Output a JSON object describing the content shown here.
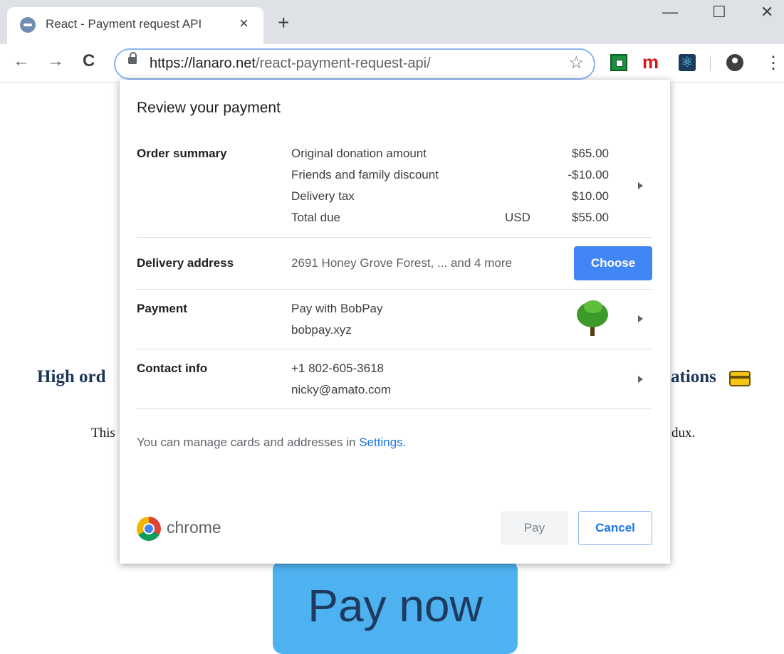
{
  "browser": {
    "tab_title": "React - Payment request API",
    "tab_close": "×",
    "new_tab": "+",
    "window_controls": {
      "minimize": "—",
      "maximize": "☐",
      "close": "✕"
    },
    "nav": {
      "back": "←",
      "forward": "→",
      "reload": "C"
    },
    "url_domain": "https://lanaro.net",
    "url_path": "/react-payment-request-api/",
    "bookmark_star": "☆",
    "extension_m": "m",
    "menu": "⋮",
    "icons": [
      "favicon-icon",
      "lock-icon",
      "star-icon",
      "green-extension-icon",
      "m-extension-icon",
      "react-extension-icon",
      "profile-icon",
      "menu-icon"
    ]
  },
  "page": {
    "heading_left": "High ord",
    "heading_right": "ations",
    "text_left": "This",
    "text_right": "dux.",
    "pay_now_label": "Pay now"
  },
  "dialog": {
    "title": "Review your payment",
    "order_summary": {
      "label": "Order summary",
      "items": [
        {
          "name": "Original donation amount",
          "amount": "$65.00"
        },
        {
          "name": "Friends and family discount",
          "amount": "-$10.00"
        },
        {
          "name": "Delivery tax",
          "amount": "$10.00"
        },
        {
          "name": "Total due",
          "currency": "USD",
          "amount": "$55.00"
        }
      ]
    },
    "delivery": {
      "label": "Delivery address",
      "value": "2691 Honey Grove Forest, ... and 4 more",
      "button": "Choose"
    },
    "payment": {
      "label": "Payment",
      "line1": "Pay with BobPay",
      "line2": "bobpay.xyz"
    },
    "contact": {
      "label": "Contact info",
      "phone": "+1 802-605-3618",
      "email": "nicky@amato.com"
    },
    "manage_text": "You can manage cards and addresses in",
    "settings_link": "Settings.",
    "brand": "chrome",
    "pay_button": "Pay",
    "cancel_button": "Cancel"
  },
  "colors": {
    "accent_blue": "#4285f4",
    "link_blue": "#1a73e8",
    "pay_now_bg": "#4eb2f0"
  }
}
